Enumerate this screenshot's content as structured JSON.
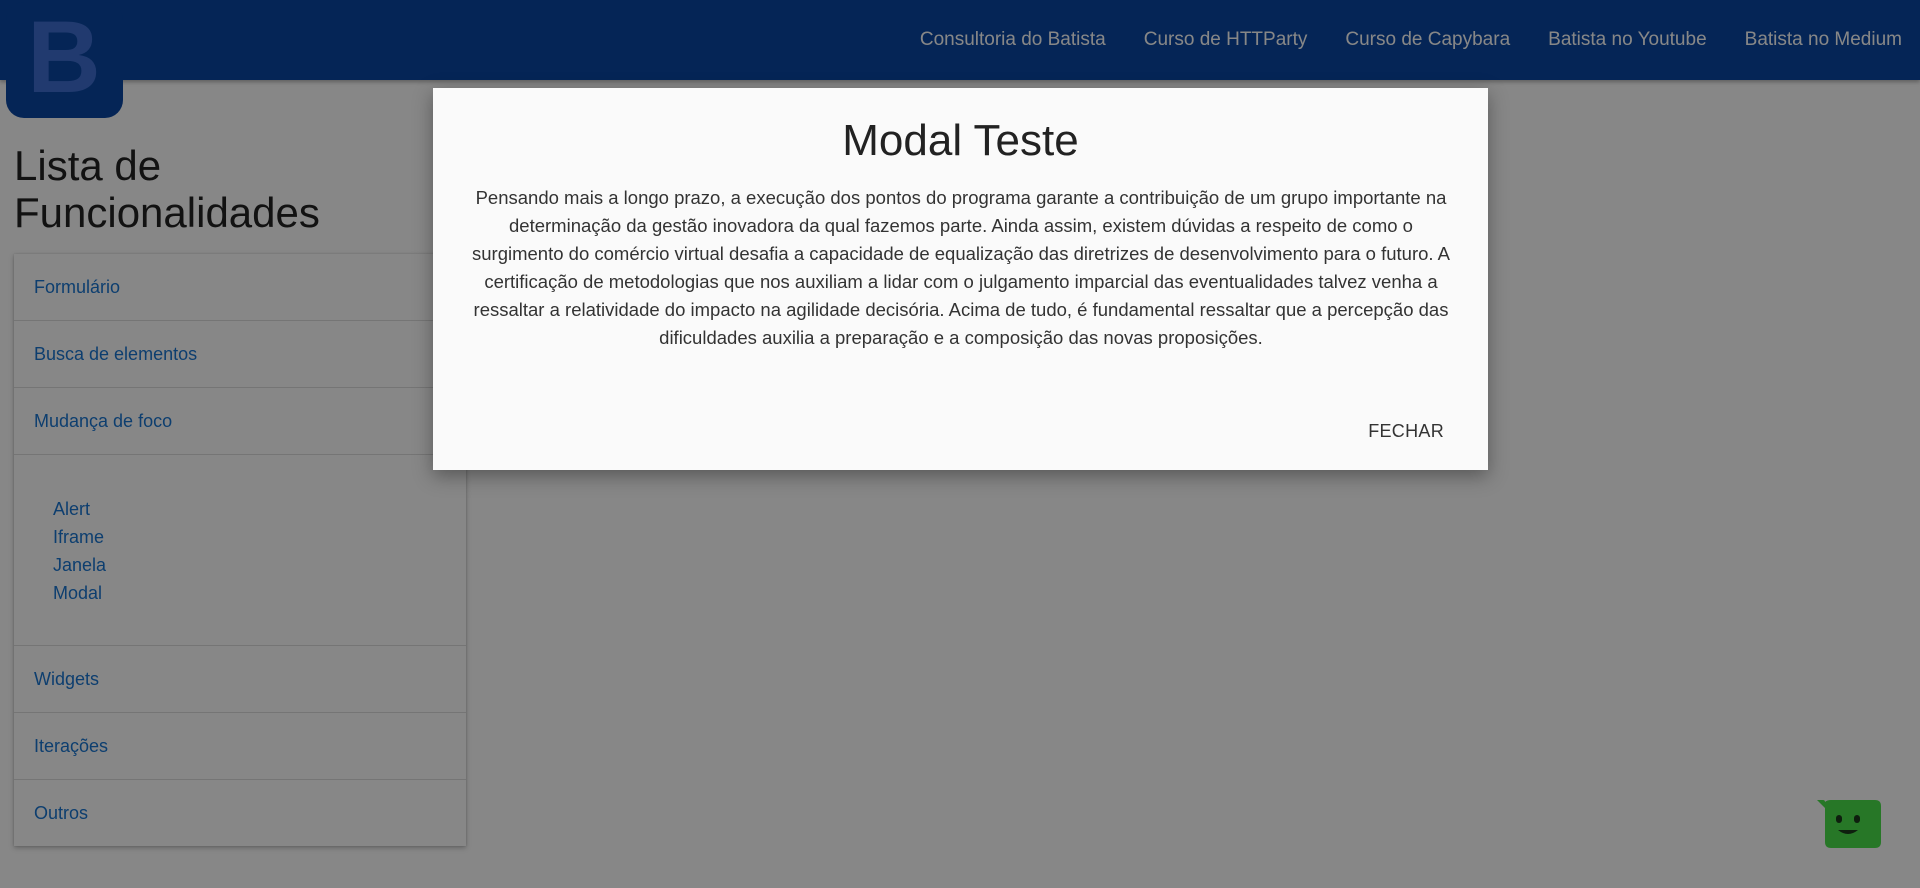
{
  "header": {
    "logo_letter": "B",
    "nav": [
      {
        "label": "Consultoria do Batista"
      },
      {
        "label": "Curso de HTTParty"
      },
      {
        "label": "Curso de Capybara"
      },
      {
        "label": "Batista no Youtube"
      },
      {
        "label": "Batista no Medium"
      }
    ]
  },
  "sidebar": {
    "title": "Lista de Funcionalidades",
    "items_top": [
      {
        "label": "Formulário"
      },
      {
        "label": "Busca de elementos"
      },
      {
        "label": "Mudança de foco"
      }
    ],
    "subitems": [
      {
        "label": "Alert"
      },
      {
        "label": "Iframe"
      },
      {
        "label": "Janela"
      },
      {
        "label": "Modal"
      }
    ],
    "items_bottom": [
      {
        "label": "Widgets"
      },
      {
        "label": "Iterações"
      },
      {
        "label": "Outros"
      }
    ]
  },
  "modal": {
    "title": "Modal Teste",
    "body": "Pensando mais a longo prazo, a execução dos pontos do programa garante a contribuição de um grupo importante na determinação da gestão inovadora da qual fazemos parte. Ainda assim, existem dúvidas a respeito de como o surgimento do comércio virtual desafia a capacidade de equalização das diretrizes de desenvolvimento para o futuro. A certificação de metodologias que nos auxiliam a lidar com o julgamento imparcial das eventualidades talvez venha a ressaltar a relatividade do impacto na agilidade decisória. Acima de tudo, é fundamental ressaltar que a percepção das dificuldades auxilia a preparação e a composição das novas proposições.",
    "close_label": "FECHAR"
  },
  "colors": {
    "header_bg": "#0a47a3",
    "link": "#1976d2",
    "chat_widget": "#4be14b"
  },
  "icons": {
    "chat": "chat-bot-icon"
  }
}
